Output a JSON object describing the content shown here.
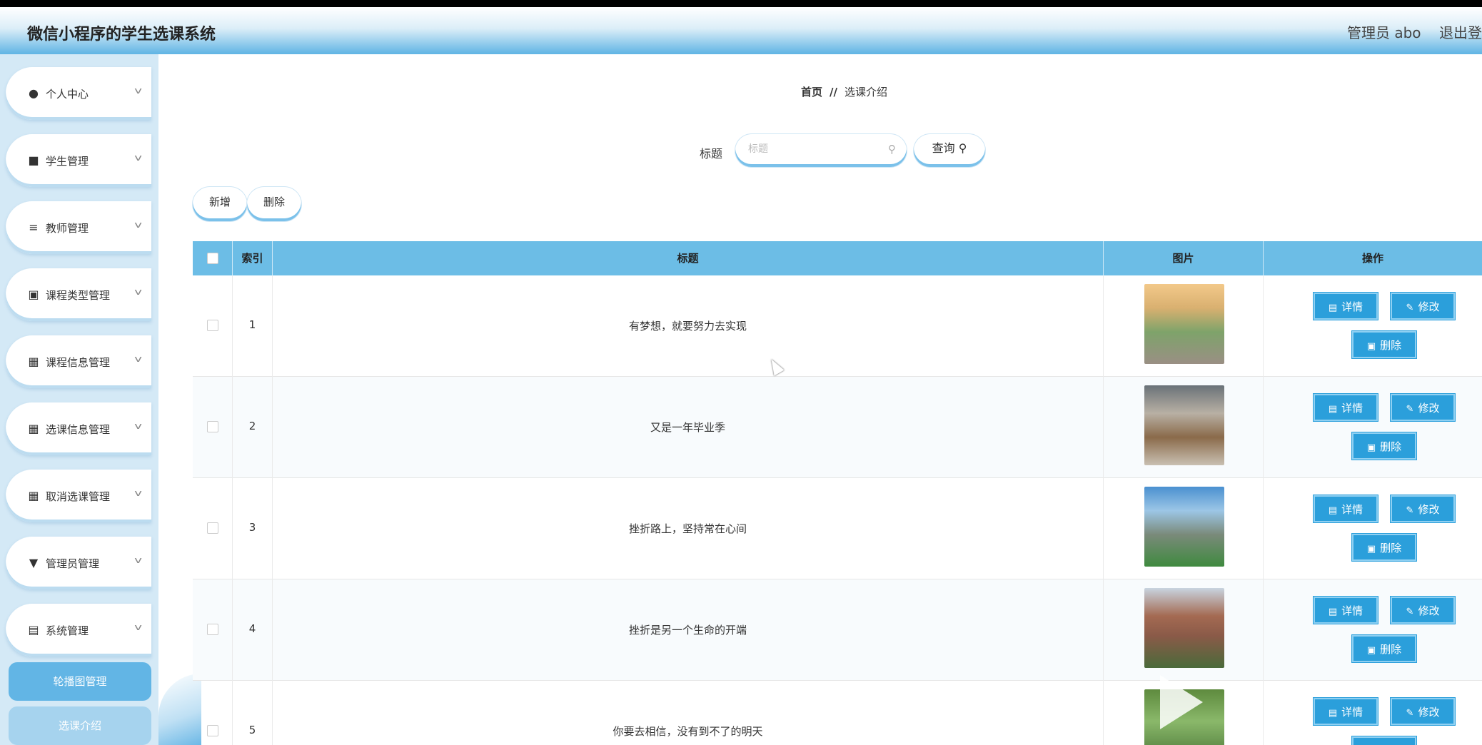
{
  "app": {
    "title": "微信小程序的学生选课系统",
    "admin_label": "管理员 abo",
    "logout_label": "退出登"
  },
  "sidebar": {
    "items": [
      {
        "label": "个人中心",
        "icon": "user-icon"
      },
      {
        "label": "学生管理",
        "icon": "briefcase-icon"
      },
      {
        "label": "教师管理",
        "icon": "sliders-icon"
      },
      {
        "label": "课程类型管理",
        "icon": "clipboard-icon"
      },
      {
        "label": "课程信息管理",
        "icon": "grid-icon"
      },
      {
        "label": "选课信息管理",
        "icon": "grid-icon"
      },
      {
        "label": "取消选课管理",
        "icon": "grid-icon"
      },
      {
        "label": "管理员管理",
        "icon": "pin-icon"
      },
      {
        "label": "系统管理",
        "icon": "document-icon"
      }
    ],
    "subitems": [
      {
        "label": "轮播图管理",
        "active": true
      },
      {
        "label": "选课介绍",
        "active": false
      }
    ]
  },
  "breadcrumb": {
    "home": "首页",
    "separator": "//",
    "current": "选课介绍"
  },
  "search": {
    "label": "标题",
    "placeholder": "标题",
    "button_label": "查询"
  },
  "toolbar": {
    "add_label": "新增",
    "delete_label": "删除"
  },
  "table": {
    "headers": {
      "index": "索引",
      "title": "标题",
      "image": "图片",
      "actions": "操作"
    },
    "rows": [
      {
        "index": "1",
        "title": "有梦想，就要努力去实现"
      },
      {
        "index": "2",
        "title": "又是一年毕业季"
      },
      {
        "index": "3",
        "title": "挫折路上，坚持常在心间"
      },
      {
        "index": "4",
        "title": "挫折是另一个生命的开端"
      },
      {
        "index": "5",
        "title": "你要去相信，没有到不了的明天"
      }
    ],
    "actions": {
      "detail": "详情",
      "edit": "修改",
      "delete": "删除"
    }
  },
  "colors": {
    "accent": "#2b9fdb",
    "table_header": "#6cbde6",
    "sidebar_bg": "#d4e9f6"
  }
}
